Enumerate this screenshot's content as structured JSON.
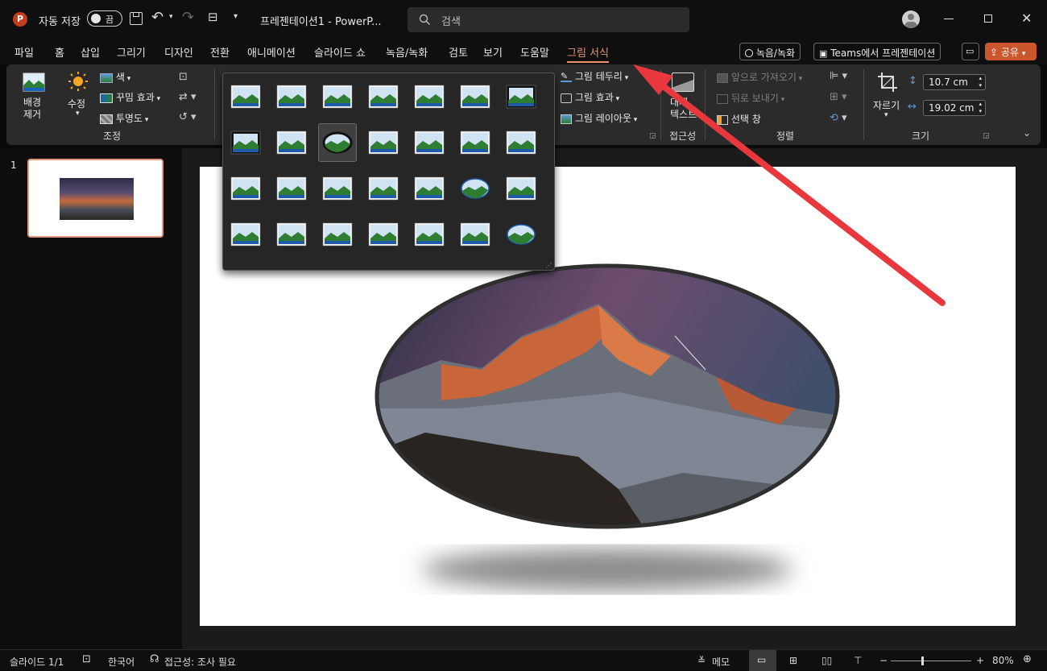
{
  "titlebar": {
    "autosave_label": "자동 저장",
    "autosave_state": "끔",
    "doc_title": "프레젠테이션1 - PowerP...",
    "search_placeholder": "검색"
  },
  "tabs": [
    "파일",
    "홈",
    "삽입",
    "그리기",
    "디자인",
    "전환",
    "애니메이션",
    "슬라이드 쇼",
    "녹음/녹화",
    "검토",
    "보기",
    "도움말",
    "그림 서식"
  ],
  "tab_buttons": {
    "record": "녹음/녹화",
    "teams": "Teams에서 프레젠테이션",
    "share": "공유"
  },
  "ribbon": {
    "remove_bg": "배경\n제거",
    "corrections": "수정",
    "color": "색",
    "artistic": "꾸밈 효과",
    "transparency": "투명도",
    "group_adjust": "조정",
    "border": "그림 테두리",
    "effects": "그림 효과",
    "layout": "그림 레이아웃",
    "alt_text": "대체\n텍스트",
    "group_access": "접근성",
    "bring_forward": "앞으로 가져오기",
    "send_backward": "뒤로 보내기",
    "selection_pane": "선택 창",
    "group_arrange": "정렬",
    "crop": "자르기",
    "height": "10.7 cm",
    "width": "19.02 cm",
    "group_size": "크기"
  },
  "slides": {
    "number": "1"
  },
  "status": {
    "slide_count": "슬라이드 1/1",
    "language": "한국어",
    "accessibility": "접근성: 조사 필요",
    "notes": "메모",
    "zoom": "80%"
  },
  "colors": {
    "accent": "#f0916a",
    "arrow": "#e8383e",
    "share_bg": "#c9562d"
  }
}
